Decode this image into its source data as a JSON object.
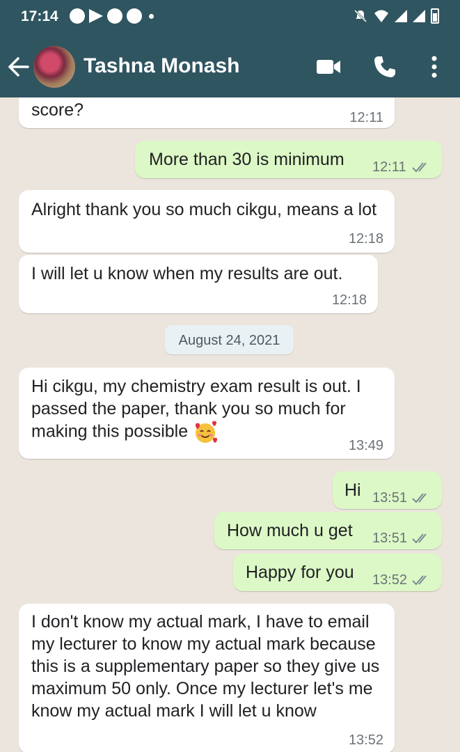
{
  "status_bar": {
    "time": "17:14"
  },
  "header": {
    "contact_name": "Tashna Monash"
  },
  "date_divider": "August 24, 2021",
  "messages": [
    {
      "direction": "incoming",
      "text": "score?",
      "time": "12:11"
    },
    {
      "direction": "outgoing",
      "text": "More than 30 is minimum",
      "time": "12:11",
      "read": true
    },
    {
      "direction": "incoming",
      "text": "Alright thank you so much cikgu, means a lot",
      "time": "12:18"
    },
    {
      "direction": "incoming",
      "text": "I will let u know when my results are out.",
      "time": "12:18"
    },
    {
      "direction": "incoming",
      "text": "Hi cikgu, my chemistry exam result is out. I passed the paper, thank you so much for making this possible",
      "emoji": "smiling-face-with-hearts",
      "time": "13:49"
    },
    {
      "direction": "outgoing",
      "text": "Hi",
      "time": "13:51",
      "read": true
    },
    {
      "direction": "outgoing",
      "text": "How much u get",
      "time": "13:51",
      "read": true
    },
    {
      "direction": "outgoing",
      "text": "Happy for you",
      "time": "13:52",
      "read": true
    },
    {
      "direction": "incoming",
      "text": "I don't know my actual mark, I have to email my lecturer to know my actual mark because this is a supplementary paper so they give us maximum 50 only. Once my lecturer let's me know my actual mark I will let u know",
      "time": "13:52"
    }
  ],
  "colors": {
    "header": "#2f5560",
    "chat_background": "#ece5dd",
    "incoming_bubble": "#ffffff",
    "outgoing_bubble": "#dcf8c6",
    "read_ticks": "#7c8a91"
  },
  "icons": [
    "back-arrow-icon",
    "video-call-icon",
    "voice-call-icon",
    "more-options-icon",
    "read-receipt-icon"
  ]
}
